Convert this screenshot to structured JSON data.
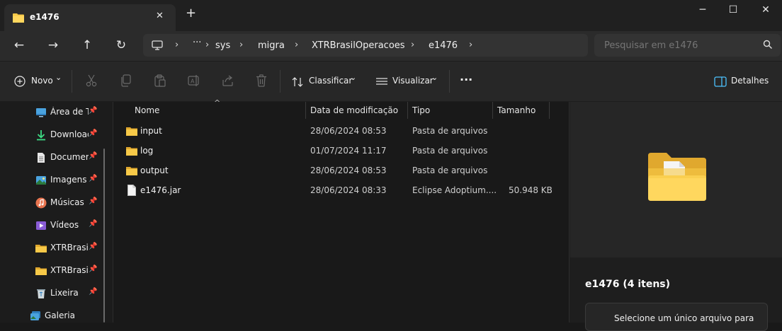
{
  "window": {
    "tab_title": "e1476",
    "tab_close_glyph": "✕",
    "new_tab_glyph": "+",
    "minimize_glyph": "─",
    "maximize_glyph": "☐",
    "close_glyph": "✕"
  },
  "nav": {
    "back_glyph": "←",
    "forward_glyph": "→",
    "up_glyph": "↑",
    "refresh_glyph": "↻"
  },
  "breadcrumb": {
    "computer_icon": "monitor-icon",
    "ellipsis": "···",
    "separator": "›",
    "items": [
      "sys",
      "migra",
      "XTRBrasilOperacoes",
      "e1476"
    ]
  },
  "search": {
    "placeholder": "Pesquisar em e1476"
  },
  "toolbar": {
    "new_label": "Novo",
    "sort_label": "Classificar",
    "view_label": "Visualizar",
    "more_glyph": "···",
    "details_label": "Detalhes",
    "chevron": "⌄"
  },
  "sidebar": {
    "pin_glyph": "📌",
    "items": [
      {
        "label": "Área de Trabalho",
        "icon": "desktop-icon",
        "pinned": true
      },
      {
        "label": "Downloads",
        "icon": "download-icon",
        "pinned": true
      },
      {
        "label": "Documentos",
        "icon": "document-icon",
        "pinned": true
      },
      {
        "label": "Imagens",
        "icon": "image-icon",
        "pinned": true
      },
      {
        "label": "Músicas",
        "icon": "music-icon",
        "pinned": true
      },
      {
        "label": "Vídeos",
        "icon": "video-icon",
        "pinned": true
      },
      {
        "label": "XTRBrasilOperacoes",
        "icon": "folder-icon",
        "pinned": true
      },
      {
        "label": "XTRBrasilOperacoes",
        "icon": "folder-icon",
        "pinned": true
      },
      {
        "label": "Lixeira",
        "icon": "recycle-bin-icon",
        "pinned": true
      },
      {
        "label": "Galeria",
        "icon": "gallery-icon",
        "pinned": false
      }
    ]
  },
  "columns": {
    "name": "Nome",
    "date": "Data de modificação",
    "type": "Tipo",
    "size": "Tamanho",
    "sort_glyph": "^"
  },
  "files": [
    {
      "name": "input",
      "date": "28/06/2024 08:53",
      "type": "Pasta de arquivos",
      "size": "",
      "icon": "folder-icon"
    },
    {
      "name": "log",
      "date": "01/07/2024 11:17",
      "type": "Pasta de arquivos",
      "size": "",
      "icon": "folder-icon"
    },
    {
      "name": "output",
      "date": "28/06/2024 08:53",
      "type": "Pasta de arquivos",
      "size": "",
      "icon": "folder-icon"
    },
    {
      "name": "e1476.jar",
      "date": "28/06/2024 08:33",
      "type": "Eclipse Adoptium....",
      "size": "50.948 KB",
      "icon": "file-icon"
    }
  ],
  "details": {
    "title": "e1476 (4 itens)",
    "hint": "Selecione um único arquivo para"
  },
  "colors": {
    "folder_yellow": "#f7c948",
    "accent_blue": "#4cc2ff",
    "background": "#191919"
  }
}
